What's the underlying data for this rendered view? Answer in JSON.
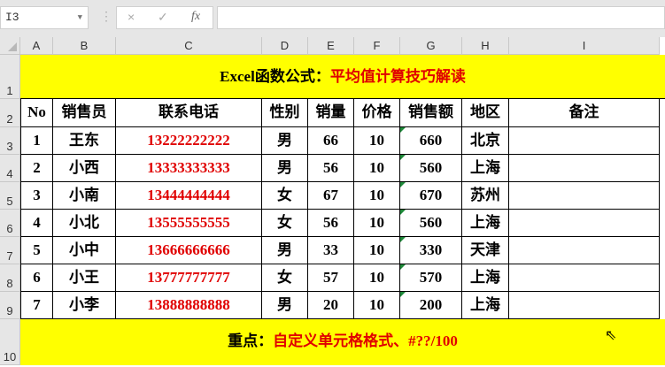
{
  "formula_bar": {
    "name_box": "I3",
    "cancel_icon": "×",
    "enter_icon": "✓",
    "fx_label": "fx",
    "formula": ""
  },
  "columns": [
    "A",
    "B",
    "C",
    "D",
    "E",
    "F",
    "G",
    "H",
    "I"
  ],
  "rows": [
    "1",
    "2",
    "3",
    "4",
    "5",
    "6",
    "7",
    "8",
    "9",
    "10"
  ],
  "title": {
    "prefix": "Excel函数公式：",
    "main": "平均值计算技巧解读"
  },
  "headers": [
    "No",
    "销售员",
    "联系电话",
    "性别",
    "销量",
    "价格",
    "销售额",
    "地区",
    "备注"
  ],
  "data": [
    [
      "1",
      "王东",
      "13222222222",
      "男",
      "66",
      "10",
      "660",
      "北京",
      ""
    ],
    [
      "2",
      "小西",
      "13333333333",
      "男",
      "56",
      "10",
      "560",
      "上海",
      ""
    ],
    [
      "3",
      "小南",
      "13444444444",
      "女",
      "67",
      "10",
      "670",
      "苏州",
      ""
    ],
    [
      "4",
      "小北",
      "13555555555",
      "女",
      "56",
      "10",
      "560",
      "上海",
      ""
    ],
    [
      "5",
      "小中",
      "13666666666",
      "男",
      "33",
      "10",
      "330",
      "天津",
      ""
    ],
    [
      "6",
      "小王",
      "13777777777",
      "女",
      "57",
      "10",
      "570",
      "上海",
      ""
    ],
    [
      "7",
      "小李",
      "13888888888",
      "男",
      "20",
      "10",
      "200",
      "上海",
      ""
    ]
  ],
  "footer": {
    "prefix": "重点：",
    "main": "自定义单元格格式、#??/100"
  },
  "colors": {
    "banner": "#ffff00",
    "accent_red": "#e00000"
  }
}
